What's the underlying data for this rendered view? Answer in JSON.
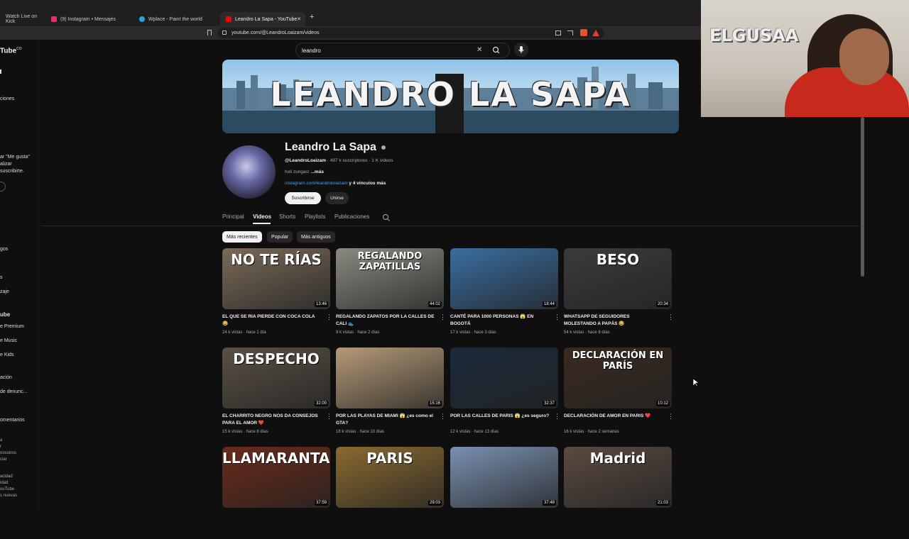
{
  "browser": {
    "tabs": [
      {
        "label": "Watch Live on Kick",
        "color": "#53fc18"
      },
      {
        "label": "(9) Instagram • Mensajes",
        "color": "#e1306c"
      },
      {
        "label": "Wplace - Paint the world",
        "color": "#29a3d6"
      },
      {
        "label": "Leandro La Sapa - YouTube",
        "color": "#ff0000"
      }
    ],
    "new_tab": "+",
    "close_tab": "✕",
    "url": "youtube.com/@LeandroLoaizam/videos"
  },
  "sidebar": {
    "logo": "Tube",
    "logo_sup": "CO",
    "fragments": [
      "ciones",
      "ar \"Me gusta\"",
      "alizar",
      "suscribirte.",
      "gos",
      "s",
      "zaje",
      "ube",
      "e Premium",
      "e Music",
      "e Kids",
      "ación",
      "de denunc...",
      "omentarios",
      "a",
      "r",
      "nosotros",
      "ciar",
      "acidad",
      "idad",
      "ouTube",
      "s nuevas"
    ]
  },
  "search": {
    "value": "leandro",
    "clear": "✕"
  },
  "banner": {
    "title": "LEANDRO LA SAPA"
  },
  "channel": {
    "name": "Leandro La Sapa",
    "handle": "@LeandroLoaizam",
    "stats": " · 497 k suscriptores · 1 K videos",
    "description": "holi zungas!",
    "more": "...más",
    "link": "instagram.com/leandroloaizam",
    "link_more": " y 4 vínculos más",
    "subscribe": "Suscribirse",
    "join": "Unirse"
  },
  "tabs": [
    "Principal",
    "Videos",
    "Shorts",
    "Playlists",
    "Publicaciones"
  ],
  "chips": [
    "Más recientes",
    "Popular",
    "Más antiguos"
  ],
  "videos": [
    {
      "title": "EL QUE SE RIA PIERDE CON COCA COLA 😂",
      "meta": "24 k vistas · hace 1 día",
      "duration": "13:46",
      "thumb_text": "NO TE RÍAS",
      "thumb_color": "#7a6a58"
    },
    {
      "title": "REGALANDO ZAPATOS POR LA CALLES DE CALI 👟",
      "meta": "9 k vistas · hace 2 días",
      "duration": "44:02",
      "thumb_text": "REGALANDO ZAPATILLAS",
      "thumb_color": "#8a8a80"
    },
    {
      "title": "CANTÉ PARA 1000 PERSONAS 😱 EN BOGOTÁ",
      "meta": "17 k vistas · hace 3 días",
      "duration": "18:44",
      "thumb_text": "",
      "thumb_color": "#3a6ea0"
    },
    {
      "title": "WHATSAPP DE SEGUIDORES MOLESTANDO A PAPÁS 😂",
      "meta": "54 k vistas · hace 6 días",
      "duration": "20:34",
      "thumb_text": "BESO",
      "thumb_color": "#3b3b3b"
    },
    {
      "title": "EL CHARRITO NEGRO NOS DA CONSEJOS PARA EL AMOR ❤️",
      "meta": "15 k vistas · hace 8 días",
      "duration": "32:00",
      "thumb_text": "DESPECHO",
      "thumb_color": "#5a5044"
    },
    {
      "title": "POR LAS PLAYAS DE MIAMI 😱 ¿es como el GTA?",
      "meta": "18 k vistas · hace 10 días",
      "duration": "15:16",
      "thumb_text": "",
      "thumb_color": "#b59a78"
    },
    {
      "title": "POR LAS CALLES DE PARIS 😱 ¿es seguro?",
      "meta": "12 k vistas · hace 13 días",
      "duration": "32:37",
      "thumb_text": "",
      "thumb_color": "#1b2a3a"
    },
    {
      "title": "DECLARACIÓN DE AMOR EN PARIS ❤️",
      "meta": "16 k vistas · hace 2 semanas",
      "duration": "10:12",
      "thumb_text": "DECLARACIÓN EN PARÍS",
      "thumb_color": "#3a2a20"
    },
    {
      "title": "",
      "meta": "",
      "duration": "37:59",
      "thumb_text": "LLAMARANTAL",
      "thumb_color": "#6a2a1a"
    },
    {
      "title": "",
      "meta": "",
      "duration": "29:03",
      "thumb_text": "PARIS",
      "thumb_color": "#8a6a30"
    },
    {
      "title": "",
      "meta": "",
      "duration": "37:48",
      "thumb_text": "",
      "thumb_color": "#7a90b0"
    },
    {
      "title": "",
      "meta": "",
      "duration": "21:03",
      "thumb_text": "Madrid",
      "thumb_color": "#5a4a40"
    }
  ],
  "webcam": {
    "sign": "ELGUSAA"
  }
}
